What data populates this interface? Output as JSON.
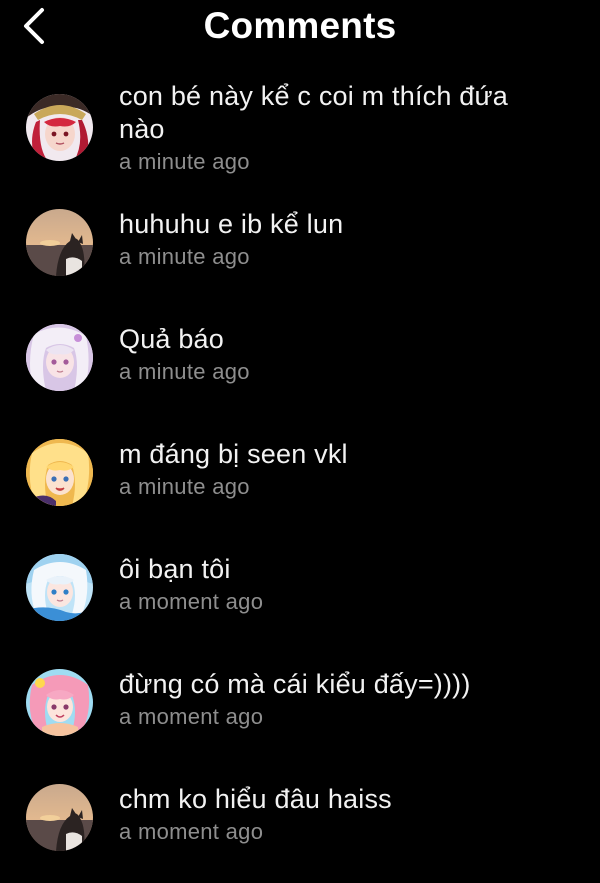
{
  "header": {
    "title": "Comments"
  },
  "comments": [
    {
      "avatar_icon": "avatar-anime-red-hair-hat",
      "text": "con bé này kể c coi m thích đứa nào",
      "time": "a minute ago"
    },
    {
      "avatar_icon": "avatar-sunset-cat",
      "text": "huhuhu e ib kể lun",
      "time": "a minute ago"
    },
    {
      "avatar_icon": "avatar-anime-white-hair",
      "text": "Quả báo",
      "time": "a minute ago"
    },
    {
      "avatar_icon": "avatar-anime-blonde",
      "text": "m đáng bị seen vkl",
      "time": "a minute ago"
    },
    {
      "avatar_icon": "avatar-anime-blue-white",
      "text": "ôi bạn tôi",
      "time": "a moment ago"
    },
    {
      "avatar_icon": "avatar-anime-pink-hair",
      "text": "đừng có mà cái kiểu đấy=))))",
      "time": "a moment ago"
    },
    {
      "avatar_icon": "avatar-sunset-cat",
      "text": "chm ko hiểu đâu haiss",
      "time": "a moment ago"
    }
  ],
  "colors": {
    "background": "#000000",
    "text": "#f2f2f2",
    "timestamp": "#8e8e8e"
  }
}
